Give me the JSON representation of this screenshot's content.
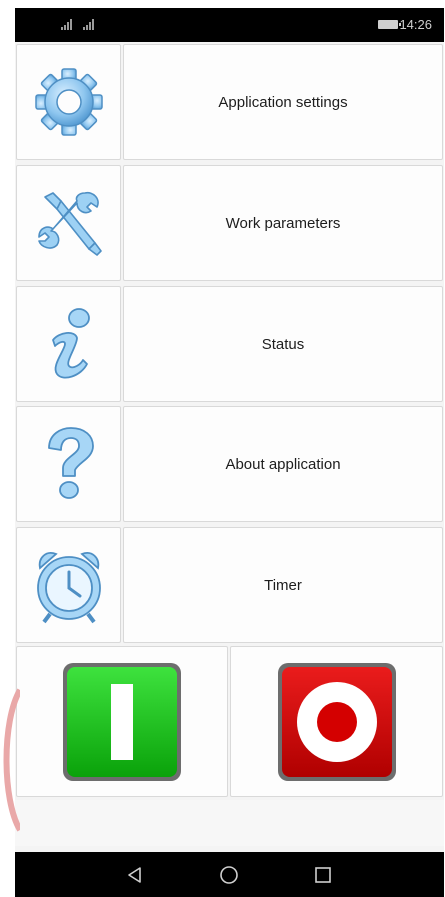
{
  "status_bar": {
    "time": "14:26",
    "signal_icon": "signal-icon",
    "battery_icon": "battery-icon"
  },
  "menu": {
    "items": [
      {
        "label": "Application settings",
        "icon": "gear-icon"
      },
      {
        "label": "Work parameters",
        "icon": "wrench-screwdriver-icon"
      },
      {
        "label": "Status",
        "icon": "info-icon"
      },
      {
        "label": "About application",
        "icon": "question-icon"
      },
      {
        "label": "Timer",
        "icon": "alarm-clock-icon"
      }
    ]
  },
  "controls": {
    "start_icon": "power-on-icon",
    "start_color": "#1fc41f",
    "stop_icon": "power-off-icon",
    "stop_color": "#d40000"
  },
  "nav_bar": {
    "back_icon": "back-icon",
    "home_icon": "home-icon",
    "recents_icon": "recents-icon"
  },
  "colors": {
    "icon_blue": "#8ec6ef",
    "background": "#f4f4f4"
  }
}
